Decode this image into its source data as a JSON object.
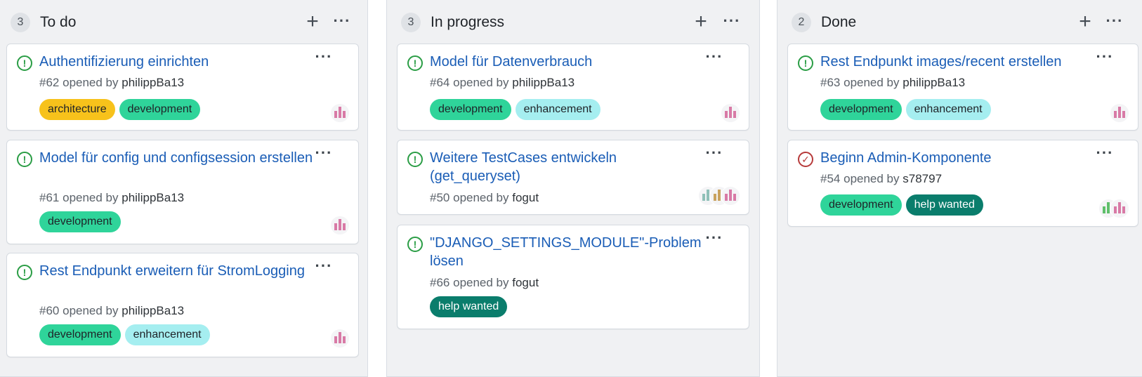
{
  "colors": {
    "open_icon": "#2a9d45",
    "closed_icon": "#b73a3a",
    "title_link": "#1a5db6"
  },
  "label_styles": {
    "architecture": {
      "bg": "#f7c21b",
      "fg": "#1f2328"
    },
    "development": {
      "bg": "#2fd49a",
      "fg": "#1f2328"
    },
    "enhancement": {
      "bg": "#a5eef0",
      "fg": "#1f2328"
    },
    "help wanted": {
      "bg": "#0a7d6c",
      "fg": "#ffffff"
    }
  },
  "columns": [
    {
      "count": "3",
      "title": "To do",
      "cards": [
        {
          "status": "open",
          "title": "Authentifizierung einrichten",
          "number": "#62",
          "opened_by": "opened by",
          "author": "philippBa13",
          "labels": [
            "architecture",
            "development"
          ],
          "avatars": [
            "avatar-philippba13"
          ]
        },
        {
          "status": "open",
          "title": "Model für config und configsession erstellen",
          "number": "#61",
          "opened_by": "opened by",
          "author": "philippBa13",
          "labels": [
            "development"
          ],
          "avatars": [
            "avatar-philippba13"
          ]
        },
        {
          "status": "open",
          "title": "Rest Endpunkt erweitern für StromLogging",
          "number": "#60",
          "opened_by": "opened by",
          "author": "philippBa13",
          "labels": [
            "development",
            "enhancement"
          ],
          "avatars": [
            "avatar-philippba13"
          ]
        }
      ]
    },
    {
      "count": "3",
      "title": "In progress",
      "cards": [
        {
          "status": "open",
          "title": "Model für Datenverbrauch",
          "number": "#64",
          "opened_by": "opened by",
          "author": "philippBa13",
          "labels": [
            "development",
            "enhancement"
          ],
          "avatars": [
            "avatar-philippba13"
          ]
        },
        {
          "status": "open",
          "title": "Weitere TestCases entwickeln (get_queryset)",
          "number": "#50",
          "opened_by": "opened by",
          "author": "fogut",
          "labels": [],
          "avatars": [
            "avatar-philippba13",
            "avatar-fogut",
            "avatar-contributor"
          ]
        },
        {
          "status": "open",
          "title": "\"DJANGO_SETTINGS_MODULE\"-Problem lösen",
          "number": "#66",
          "opened_by": "opened by",
          "author": "fogut",
          "labels": [
            "help wanted"
          ],
          "avatars": []
        }
      ]
    },
    {
      "count": "2",
      "title": "Done",
      "cards": [
        {
          "status": "open",
          "title": "Rest Endpunkt images/recent erstellen",
          "number": "#63",
          "opened_by": "opened by",
          "author": "philippBa13",
          "labels": [
            "development",
            "enhancement"
          ],
          "avatars": [
            "avatar-philippba13"
          ]
        },
        {
          "status": "closed",
          "title": "Beginn Admin-Komponente",
          "number": "#54",
          "opened_by": "opened by",
          "author": "s78797",
          "labels": [
            "development",
            "help wanted"
          ],
          "avatars": [
            "avatar-philippba13",
            "avatar-s78797"
          ]
        }
      ]
    }
  ]
}
